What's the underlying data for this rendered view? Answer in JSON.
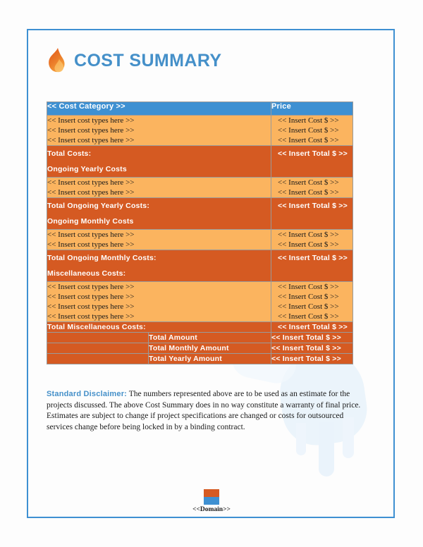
{
  "document": {
    "title": "COST SUMMARY",
    "logo_icon": "flame-icon"
  },
  "colors": {
    "header_blue": "#3e90d2",
    "light_orange": "#fbb45f",
    "dark_orange": "#d55a22",
    "title_blue": "#4590c9",
    "border_blue": "#3e90d2"
  },
  "table": {
    "columns": [
      {
        "label": "<< Cost Category >>"
      },
      {
        "label": "Price"
      }
    ],
    "rows": [
      {
        "type": "items",
        "items": [
          "<< Insert cost types here >>",
          "<< Insert cost types here >>",
          "<< Insert cost types here >>"
        ],
        "prices": [
          "<< Insert Cost $ >>",
          "<< Insert Cost $ >>",
          "<< Insert Cost $ >>"
        ]
      },
      {
        "type": "total",
        "labels": [
          "Total Costs:",
          "Ongoing Yearly Costs"
        ],
        "price": "<< Insert Total $ >>"
      },
      {
        "type": "items",
        "items": [
          "<< Insert cost types here >>",
          "<< Insert cost types here >>"
        ],
        "prices": [
          "<< Insert Cost $ >>",
          "<< Insert Cost $ >>"
        ]
      },
      {
        "type": "total",
        "labels": [
          "Total Ongoing Yearly Costs:",
          "Ongoing Monthly Costs"
        ],
        "price": "<< Insert Total $ >>"
      },
      {
        "type": "items",
        "items": [
          "<< Insert cost types here >>",
          "<< Insert cost types here >>"
        ],
        "prices": [
          "<< Insert Cost $ >>",
          "<< Insert Cost $ >>"
        ]
      },
      {
        "type": "total",
        "labels": [
          "Total Ongoing Monthly Costs:",
          "Miscellaneous Costs:"
        ],
        "price": "<< Insert Total $ >>"
      },
      {
        "type": "items",
        "items": [
          "<< Insert cost types here >>",
          "<< Insert cost types here >>",
          "<< Insert cost types here >>",
          "<< Insert cost types here >>"
        ],
        "prices": [
          "<< Insert Cost $ >>",
          "<< Insert Cost $ >>",
          "<< Insert Cost $ >>",
          "<< Insert Cost $ >>"
        ]
      },
      {
        "type": "total_single",
        "label": "Total Miscellaneous Costs:",
        "price": "<< Insert Total $ >>"
      }
    ],
    "grand_totals": [
      {
        "label": "Total Amount",
        "price": "<< Insert Total $ >>"
      },
      {
        "label": "Total Monthly Amount",
        "price": "<< Insert Total $ >>"
      },
      {
        "label": "Total Yearly Amount",
        "price": "<< Insert Total $ >>"
      }
    ]
  },
  "disclaimer": {
    "lead": "Standard Disclaimer:",
    "body": " The numbers represented above are to be used as an estimate for the projects discussed. The above Cost Summary does in no way constitute a warranty of final price.  Estimates are subject to change if project specifications are changed or costs for outsourced services change before being locked in by a binding contract."
  },
  "footer": {
    "logo_icon": "domain-logo-icon",
    "text": "<<Domain>>"
  }
}
